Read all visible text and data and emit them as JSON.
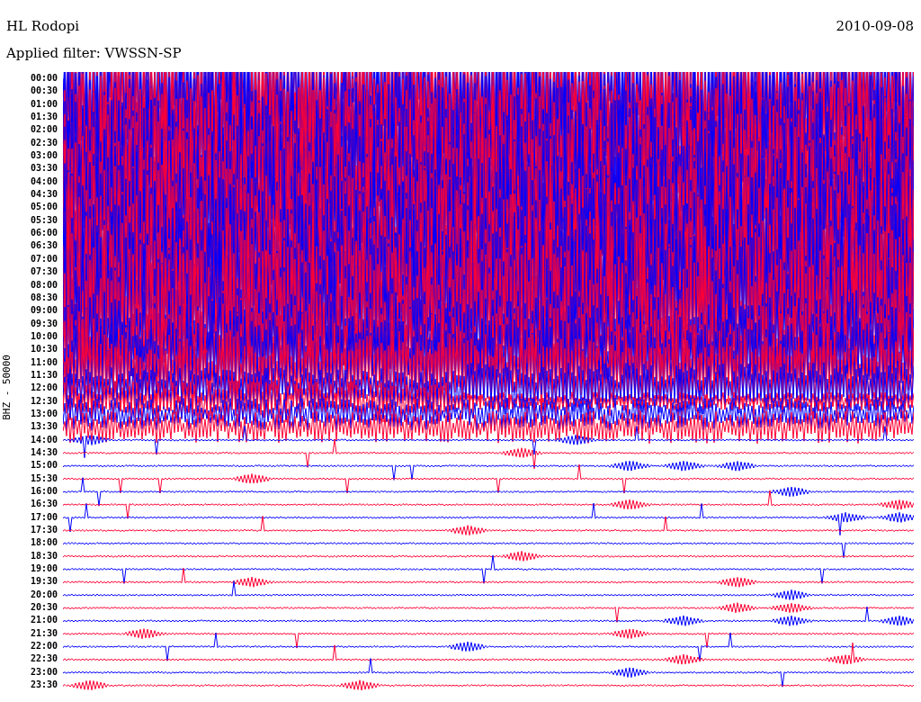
{
  "header": {
    "title": "HL Rodopi",
    "date": "2010-09-08",
    "filter": "Applied filter: VWSSN-SP"
  },
  "channel_label": "BHZ - 50000",
  "rows": [
    {
      "time": "00:00"
    },
    {
      "time": "00:30"
    },
    {
      "time": "01:00"
    },
    {
      "time": "01:30"
    },
    {
      "time": "02:00"
    },
    {
      "time": "02:30"
    },
    {
      "time": "03:00"
    },
    {
      "time": "03:30"
    },
    {
      "time": "04:00"
    },
    {
      "time": "04:30"
    },
    {
      "time": "05:00"
    },
    {
      "time": "05:30"
    },
    {
      "time": "06:00"
    },
    {
      "time": "06:30"
    },
    {
      "time": "07:00"
    },
    {
      "time": "07:30"
    },
    {
      "time": "08:00"
    },
    {
      "time": "08:30"
    },
    {
      "time": "09:00"
    },
    {
      "time": "09:30"
    },
    {
      "time": "10:00"
    },
    {
      "time": "10:30"
    },
    {
      "time": "11:00"
    },
    {
      "time": "11:30"
    },
    {
      "time": "12:00"
    },
    {
      "time": "12:30"
    },
    {
      "time": "13:00"
    },
    {
      "time": "13:30"
    },
    {
      "time": "14:00"
    },
    {
      "time": "14:30"
    },
    {
      "time": "15:00"
    },
    {
      "time": "15:30"
    },
    {
      "time": "16:00"
    },
    {
      "time": "16:30"
    },
    {
      "time": "17:00"
    },
    {
      "time": "17:30"
    },
    {
      "time": "18:00"
    },
    {
      "time": "18:30"
    },
    {
      "time": "19:00"
    },
    {
      "time": "19:30"
    },
    {
      "time": "20:00"
    },
    {
      "time": "20:30"
    },
    {
      "time": "21:00"
    },
    {
      "time": "21:30"
    },
    {
      "time": "22:00"
    },
    {
      "time": "22:30"
    },
    {
      "time": "23:00"
    },
    {
      "time": "23:30"
    }
  ]
}
